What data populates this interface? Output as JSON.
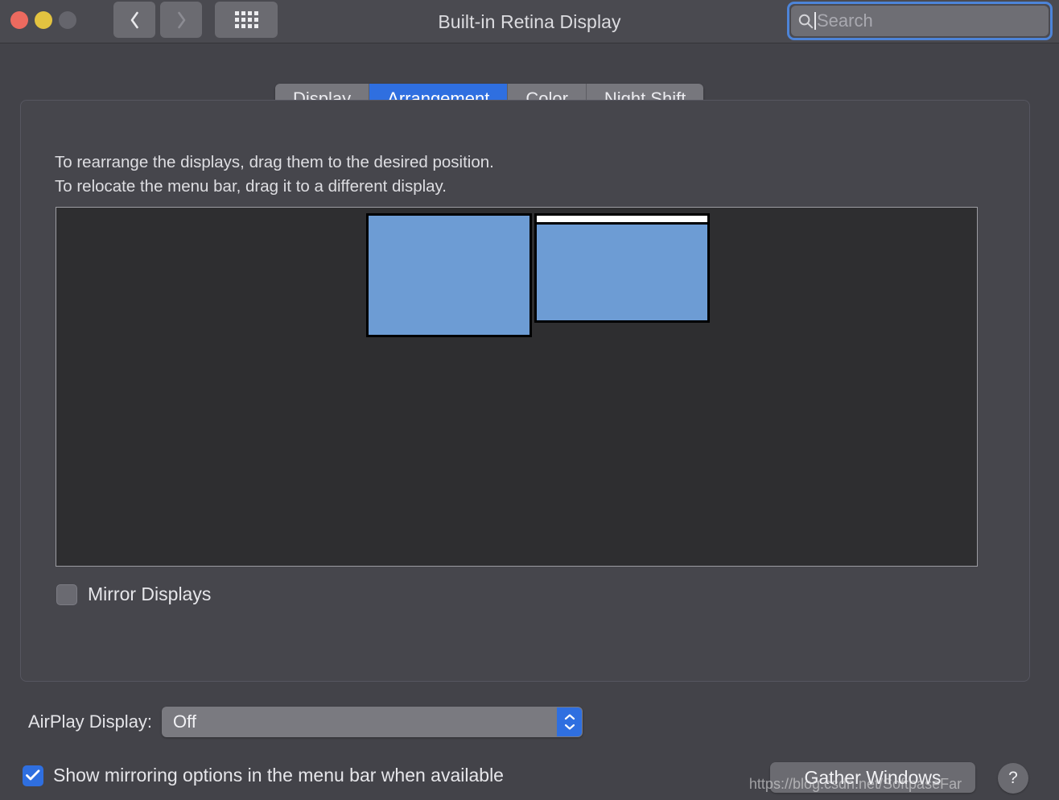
{
  "window": {
    "title": "Built-in Retina Display",
    "traffic_lights": [
      "close",
      "minimize",
      "zoom"
    ]
  },
  "toolbar": {
    "back_icon": "chevron-left-icon",
    "forward_icon": "chevron-right-icon",
    "grid_icon": "show-all-grid-icon"
  },
  "search": {
    "placeholder": "Search",
    "value": "",
    "icon": "search-icon",
    "focused": true
  },
  "tabs": [
    {
      "label": "Display",
      "active": false
    },
    {
      "label": "Arrangement",
      "active": true
    },
    {
      "label": "Color",
      "active": false
    },
    {
      "label": "Night Shift",
      "active": false
    }
  ],
  "instructions": {
    "line1": "To rearrange the displays, drag them to the desired position.",
    "line2": "To relocate the menu bar, drag it to a different display."
  },
  "arrangement": {
    "displays": [
      {
        "name": "left-display",
        "has_menu_bar": false
      },
      {
        "name": "right-display",
        "has_menu_bar": true
      }
    ],
    "display_color": "#6d9cd4",
    "canvas_color": "#2e2e30"
  },
  "mirror": {
    "label": "Mirror Displays",
    "checked": false
  },
  "airplay": {
    "label": "AirPlay Display:",
    "value": "Off",
    "options": [
      "Off"
    ]
  },
  "mirroring_menu_bar": {
    "label": "Show mirroring options in the menu bar when available",
    "checked": true
  },
  "gather": {
    "label": "Gather Windows"
  },
  "help": {
    "label": "?"
  },
  "watermark": {
    "text": "https://blog.csdn.net/SoftpaseFar"
  },
  "colors": {
    "accent": "#2f6fe0",
    "window_bg": "#434349",
    "panel_bg": "#46464c",
    "display_blue": "#6d9cd4"
  }
}
